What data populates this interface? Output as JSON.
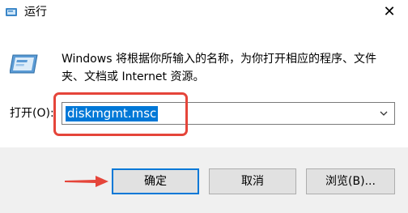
{
  "window": {
    "title": "运行",
    "close_glyph": "✕"
  },
  "icons": {
    "title_icon": "run-app-icon",
    "dialog_icon": "run-dialog-icon",
    "dropdown_icon": "chevron-down-icon",
    "annotation_arrow": "red-arrow-icon"
  },
  "description": "Windows 将根据你所输入的名称，为你打开相应的程序、文件夹、文档或 Internet 资源。",
  "open_field": {
    "label": "打开(O):",
    "value": "diskmgmt.msc"
  },
  "buttons": {
    "ok": "确定",
    "cancel": "取消",
    "browse": "浏览(B)..."
  },
  "colors": {
    "selection": "#0078d7",
    "annotation": "#e5453a",
    "footer_bg": "#f0f0f0"
  }
}
